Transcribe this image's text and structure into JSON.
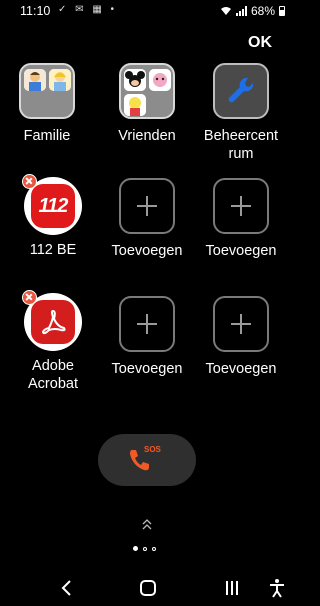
{
  "status_bar": {
    "time": "11:10",
    "left_icons": "✓ ✉ ▦ •",
    "battery": "68%"
  },
  "header": {
    "ok_label": "OK"
  },
  "row1": [
    {
      "label": "Familie"
    },
    {
      "label": "Vrienden"
    },
    {
      "label": "Beheercent\nrum"
    }
  ],
  "row2": [
    {
      "label": "112 BE",
      "app_text": "112"
    },
    {
      "label": "Toevoegen"
    },
    {
      "label": "Toevoegen"
    }
  ],
  "row3": [
    {
      "label": "Adobe Acrobat"
    },
    {
      "label": "Toevoegen"
    },
    {
      "label": "Toevoegen"
    }
  ],
  "sos": {
    "label": "SOS"
  },
  "pager": {
    "pages": 3,
    "active": 1
  },
  "colors": {
    "background": "#000000",
    "sos_accent": "#ef5a27",
    "remove_badge": "#e9563f",
    "app_red": "#e01a1a",
    "settings_blue": "#1e6ee8"
  }
}
